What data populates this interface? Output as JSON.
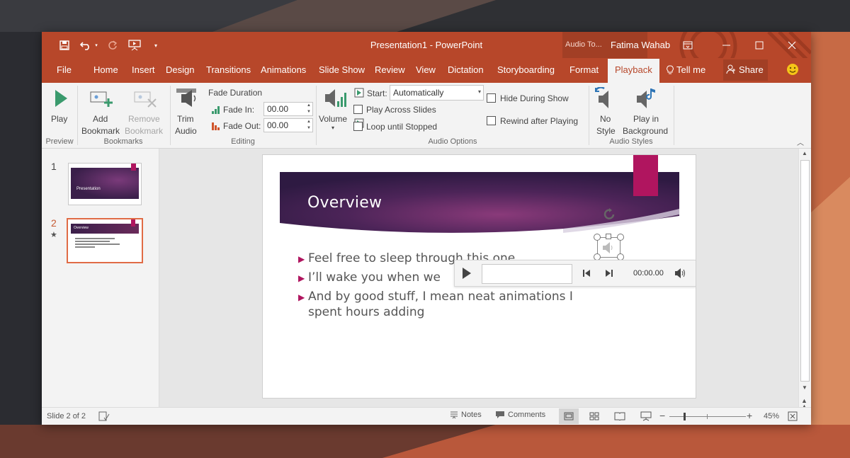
{
  "window": {
    "doc_title": "Presentation1  -  PowerPoint",
    "context_title": "Audio To...",
    "user_name": "Fatima Wahab",
    "colors": {
      "accent": "#b7472a",
      "slide_accent": "#b0155f",
      "banner": "#4a2558"
    }
  },
  "tabs": {
    "file": "File",
    "home": "Home",
    "insert": "Insert",
    "design": "Design",
    "transitions": "Transitions",
    "animations": "Animations",
    "slideshow": "Slide Show",
    "review": "Review",
    "view": "View",
    "dictation": "Dictation",
    "storyboarding": "Storyboarding",
    "format": "Format",
    "playback": "Playback",
    "tellme": "Tell me",
    "share": "Share"
  },
  "ribbon": {
    "preview": {
      "play": "Play",
      "group": "Preview"
    },
    "bookmarks": {
      "add1": "Add",
      "add2": "Bookmark",
      "remove1": "Remove",
      "remove2": "Bookmark",
      "group": "Bookmarks"
    },
    "editing": {
      "trim1": "Trim",
      "trim2": "Audio",
      "fade_duration": "Fade Duration",
      "fade_in_label": "Fade In:",
      "fade_in_value": "00.00",
      "fade_out_label": "Fade Out:",
      "fade_out_value": "00.00",
      "group": "Editing"
    },
    "audio_options": {
      "volume": "Volume",
      "start_label": "Start:",
      "start_value": "Automatically",
      "play_across": "Play Across Slides",
      "loop": "Loop until Stopped",
      "hide": "Hide During Show",
      "rewind": "Rewind after Playing",
      "group": "Audio Options"
    },
    "audio_styles": {
      "nostyle1": "No",
      "nostyle2": "Style",
      "bg1": "Play in",
      "bg2": "Background",
      "group": "Audio Styles"
    }
  },
  "thumbnails": [
    {
      "number": "1",
      "title": "Presentation"
    },
    {
      "number": "2",
      "title": "Overview"
    }
  ],
  "slide": {
    "title": "Overview",
    "bullets": [
      "Feel free to sleep through this one",
      "I’ll wake you when we",
      "And by good stuff, I mean neat animations I",
      "spent hours adding"
    ]
  },
  "player": {
    "time": "00:00.00"
  },
  "status": {
    "slide_info": "Slide 2 of 2",
    "notes": "Notes",
    "comments": "Comments",
    "zoom": "45%"
  }
}
